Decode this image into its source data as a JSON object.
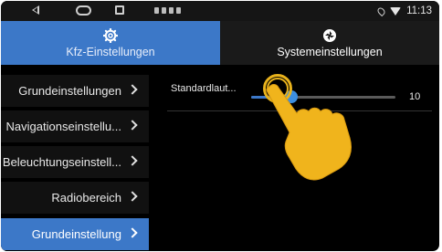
{
  "statusbar": {
    "time": "11:13",
    "icons": [
      "back-icon",
      "home-icon",
      "recent-apps-icon",
      "location-icon",
      "wifi-icon"
    ]
  },
  "tabs": [
    {
      "label": "Kfz-Einstellungen",
      "icon": "gear-icon",
      "active": true
    },
    {
      "label": "Systemeinstellungen",
      "icon": "aperture-icon",
      "active": false
    }
  ],
  "sidebar": {
    "items": [
      {
        "label": "Grundeinstellungen"
      },
      {
        "label": "Navigationseinstellu..."
      },
      {
        "label": "Beleuchtungseinstell..."
      },
      {
        "label": "Radiobereich"
      },
      {
        "label": "Grundeinstellung",
        "selected": true
      }
    ]
  },
  "content": {
    "row": {
      "label": "Standardlaut...",
      "value": "10",
      "level": 0.28
    }
  },
  "colors": {
    "accent": "#3c78c8",
    "highlight": "#e8b21c"
  }
}
